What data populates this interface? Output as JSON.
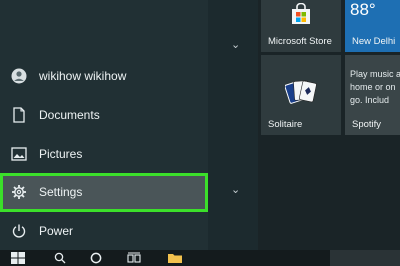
{
  "start_menu": {
    "items": [
      {
        "label": "wikihow wikihow",
        "icon": "user-icon"
      },
      {
        "label": "Documents",
        "icon": "document-icon"
      },
      {
        "label": "Pictures",
        "icon": "pictures-icon"
      },
      {
        "label": "Settings",
        "icon": "gear-icon"
      },
      {
        "label": "Power",
        "icon": "power-icon"
      }
    ],
    "highlight_color": "#3be02a"
  },
  "tiles": {
    "store": {
      "label": "Microsoft Store"
    },
    "weather": {
      "temp": "88°",
      "label": "New Delhi"
    },
    "solitaire": {
      "label": "Solitaire"
    },
    "spotify": {
      "line1": "Play music a",
      "line2": "home or on",
      "line3": "go. Includ",
      "label": "Spotify"
    }
  },
  "colors": {
    "tile_bg": "#2f3b3e",
    "weather_tile": "#1e6fb3",
    "spotify_tile": "#3a4548"
  }
}
